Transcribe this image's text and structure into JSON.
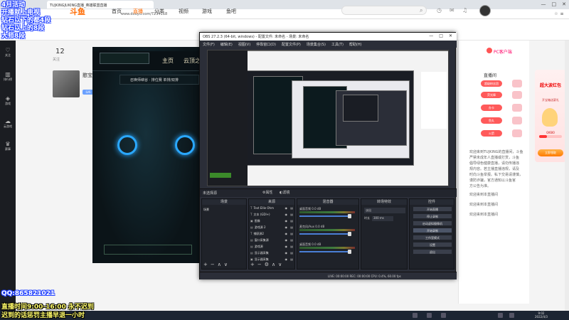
{
  "browser": {
    "tab_title": "TUJKINGJUKING直播_英雄联盟直播",
    "url": "www.douyu.com/7234118",
    "window_controls": [
      "—",
      "□",
      "✕"
    ]
  },
  "site": {
    "logo": "斗鱼",
    "nav": [
      "首页",
      "直播",
      "分类",
      "视频",
      "游戏",
      "鱼吧"
    ],
    "active_nav": "直播"
  },
  "left_rail": [
    "关注",
    "排行榜",
    "游戏",
    "云游戏",
    "赛事"
  ],
  "room": {
    "fans": "12",
    "fans_label": "关注",
    "streamer_name": "憨宝",
    "level_badge": "LV6"
  },
  "game": {
    "home": "主页",
    "cloud": "云顶之",
    "subtitle": "召唤师峡谷 · 排位赛 单排/双排"
  },
  "obs": {
    "title": "OBS 27.2.3 (64-bit, windows) - 配置文件: 未命名 - 场景: 未命名",
    "menu": [
      "文件(F)",
      "编辑(E)",
      "视图(V)",
      "停靠窗口(D)",
      "配置文件(P)",
      "场景集合(S)",
      "工具(T)",
      "帮助(H)"
    ],
    "no_source": "未选择源",
    "attr_btn": "⚙属性",
    "filter_btn": "◐滤镜",
    "docks": {
      "scenes": "场景",
      "sources": "来源",
      "mixer": "混音器",
      "transitions": "转场特效",
      "controls": "控件"
    },
    "scene_item": "场景",
    "sources": [
      {
        "icon": "T",
        "name": "Text Ellie Ohm"
      },
      {
        "icon": "T",
        "name": "文本 (GDI+)"
      },
      {
        "icon": "▣",
        "name": "图像"
      },
      {
        "icon": "▤",
        "name": "游戏源 2"
      },
      {
        "icon": "T",
        "name": "捕获源2"
      },
      {
        "icon": "▤",
        "name": "窗口采集源"
      },
      {
        "icon": "▤",
        "name": "游戏源"
      },
      {
        "icon": "▤",
        "name": "显示器采集"
      },
      {
        "icon": "▣",
        "name": "显示器采集"
      }
    ],
    "mixer": [
      {
        "name": "桌面音频",
        "db": "0.0 dB"
      },
      {
        "name": "麦克风/Aux",
        "db": "0.0 dB"
      },
      {
        "name": "桌面音频",
        "db": "0.0 dB"
      }
    ],
    "transition": "淡出",
    "duration_label": "时长",
    "duration_value": "300 ms",
    "controls": [
      "开始直播",
      "停止录制",
      "启动虚拟摄像机",
      "开始录制",
      "工作室模式",
      "设置",
      "退出"
    ],
    "status": "LIVE: 00:00:00   REC: 00:00:00   CPU: 0.4%, 60.00 fps"
  },
  "right_panel": {
    "pc_client": "PC客户端",
    "chat_header": "直播间",
    "gift_badges": [
      "超级粉丝团",
      "荧光棒",
      "办卡",
      "鱼丸",
      "火箭"
    ],
    "chat_lines": [
      "欢迎来到TUJKING的直播间，斗鱼",
      "严禁未成年人直播或打赏，斗鱼",
      "倡导绿色健康直播，请勿传播违",
      "规内容。若主播直播违规，请及",
      "时向斗鱼举报。私下交易请谨慎，",
      "谨防诈骗，官方通知以斗鱼官",
      "方公告为准。",
      "欢迎来到本直播间",
      "欢迎来到本直播间",
      "欢迎来到本直播间"
    ]
  },
  "ad": {
    "title": "超大波红包",
    "subtitle": "开宝箱送豪礼",
    "progress_text": "0/600",
    "progress": 0.35,
    "button": "立即领取"
  },
  "taskbar": {
    "time": "9:02",
    "date": "2022/4/3"
  },
  "overlay": {
    "top_left": [
      "4月活动",
      "开播就上电视",
      "钻石以下的都4段",
      "钻石以上的8段",
      "大师8段"
    ],
    "qq": "QQ:865821021",
    "schedule": "直播时间9:00-16:00 永不迟到",
    "penalty": "迟到的话惩罚主播早退一小时"
  },
  "colors": {
    "obs_bg": "#2b2e38",
    "douyu_orange": "#ff6a00",
    "overlay_outline": "#1a3bff",
    "overlay_yellow": "#fffb6a"
  }
}
